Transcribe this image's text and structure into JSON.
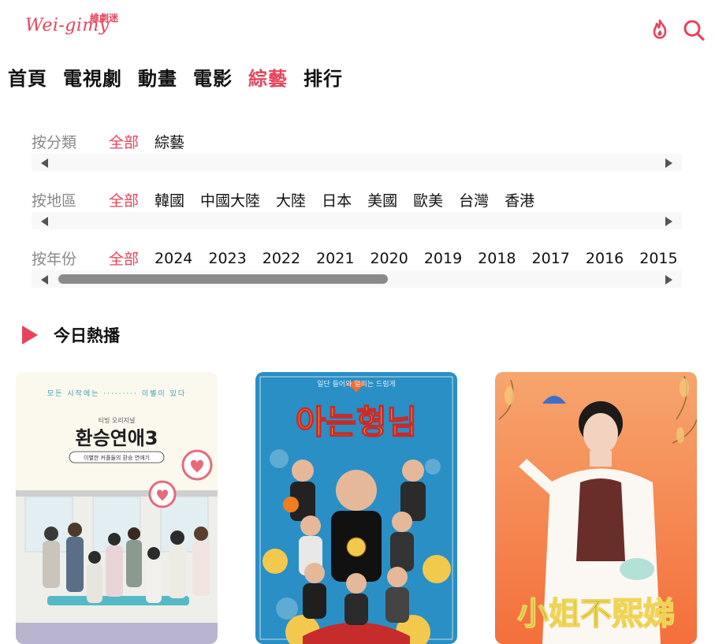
{
  "header": {
    "logo_script": "Wei-gimy",
    "logo_cn": "維劇迷",
    "hot_icon": "flame-icon",
    "search_icon": "search-icon"
  },
  "nav": {
    "items": [
      "首頁",
      "電視劇",
      "動畫",
      "電影",
      "綜藝",
      "排行"
    ],
    "active": "綜藝"
  },
  "filters": {
    "category": {
      "label": "按分類",
      "options": [
        "全部",
        "綜藝"
      ],
      "active": "全部"
    },
    "region": {
      "label": "按地區",
      "options": [
        "全部",
        "韓國",
        "中國大陸",
        "大陸",
        "日本",
        "美國",
        "歐美",
        "台灣",
        "香港"
      ],
      "active": "全部"
    },
    "year": {
      "label": "按年份",
      "options": [
        "全部",
        "2024",
        "2023",
        "2022",
        "2021",
        "2020",
        "2019",
        "2018",
        "2017",
        "2016",
        "2015"
      ],
      "active": "全部"
    }
  },
  "section": {
    "title": "今日熱播"
  },
  "posters": [
    {
      "top_text": "모든 시작에는 ········· 이별이 있다",
      "sub": "티빙 오리지널",
      "title": "환승연애3",
      "caption": "이별한 커플들의 환승 연애기"
    },
    {
      "top_text": "일단 들어와 얼리는 드림게",
      "title": "아는형님"
    },
    {
      "title": "小姐不熙娣"
    }
  ],
  "colors": {
    "accent": "#e8435a"
  }
}
